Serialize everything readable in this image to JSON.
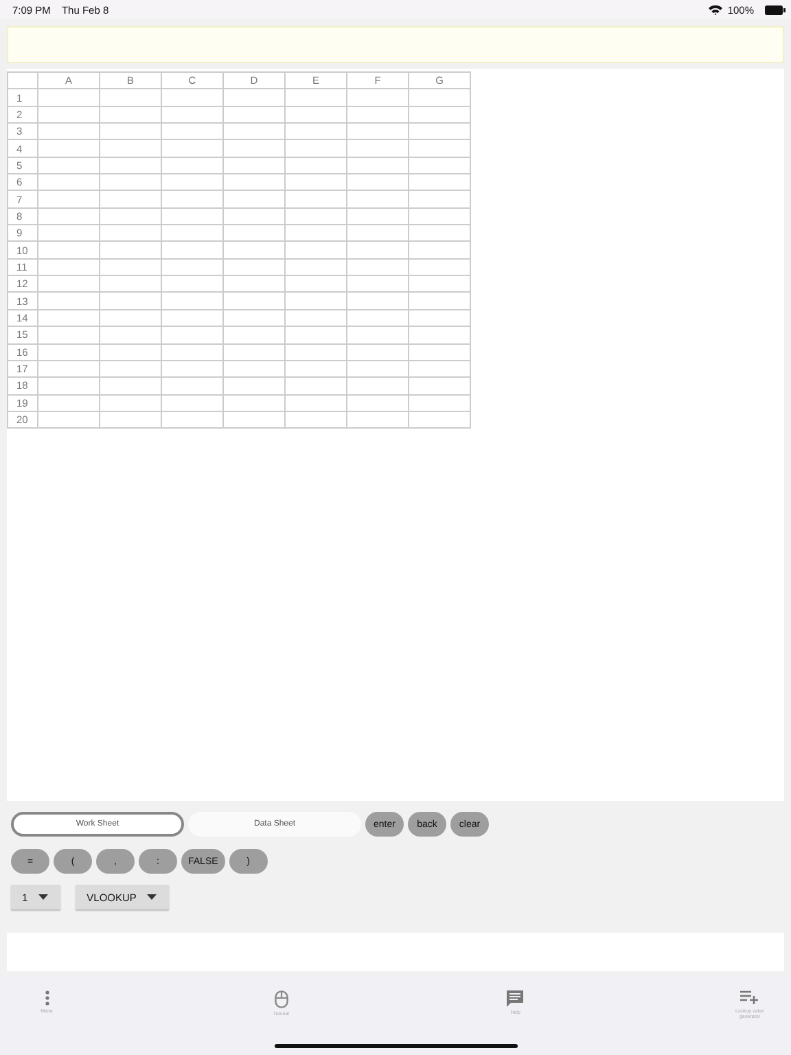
{
  "status_bar": {
    "time": "7:09 PM",
    "date": "Thu Feb 8",
    "battery": "100%"
  },
  "sheet": {
    "columns": [
      "A",
      "B",
      "C",
      "D",
      "E",
      "F",
      "G"
    ],
    "rows": [
      "1",
      "2",
      "3",
      "4",
      "5",
      "6",
      "7",
      "8",
      "9",
      "10",
      "11",
      "12",
      "13",
      "14",
      "15",
      "16",
      "17",
      "18",
      "19",
      "20"
    ]
  },
  "sheet_tabs": [
    {
      "label": "Work Sheet",
      "selected": true
    },
    {
      "label": "Data Sheet",
      "selected": false
    }
  ],
  "action_keys": [
    "enter",
    "back",
    "clear"
  ],
  "symbol_keys": [
    "=",
    "(",
    ",",
    ":",
    "FALSE",
    ")"
  ],
  "dropdowns": [
    {
      "value": "1"
    },
    {
      "value": "VLOOKUP"
    }
  ],
  "bottom_tabs": [
    {
      "label": "Menu",
      "kind": "dots"
    },
    {
      "label": "Tutorial",
      "kind": "mouse"
    },
    {
      "label": "Help",
      "kind": "chat"
    },
    {
      "label": "Lookup value generator",
      "kind": "list-add"
    }
  ]
}
